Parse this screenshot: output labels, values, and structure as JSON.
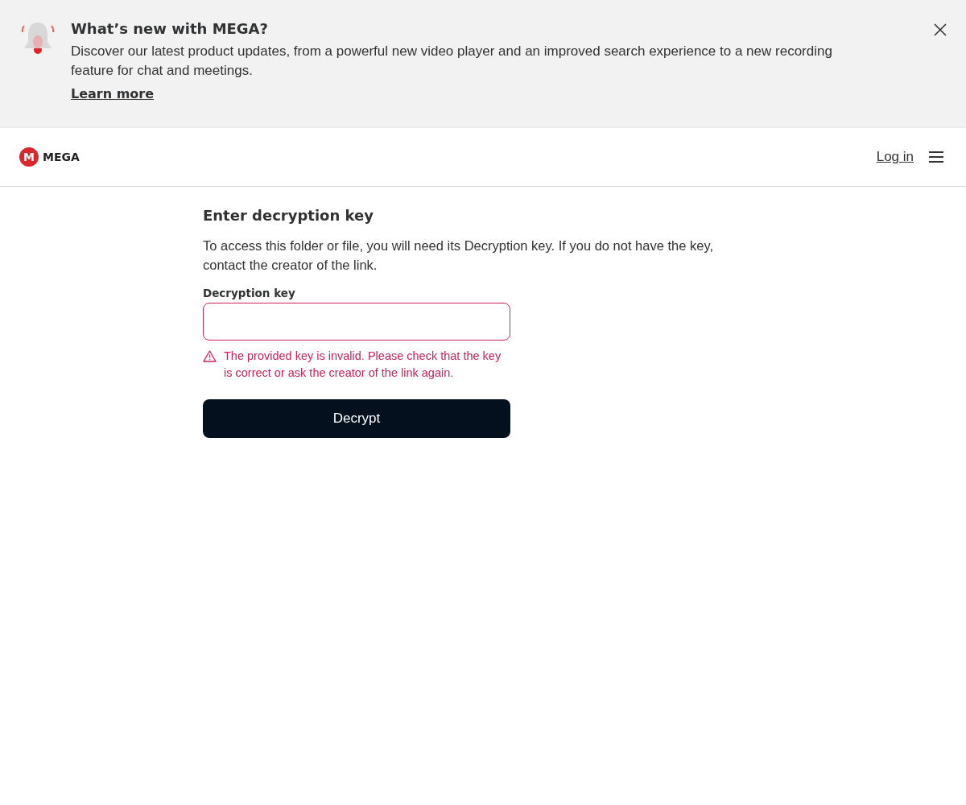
{
  "banner": {
    "title": "What’s new with MEGA?",
    "text": "Discover our latest product updates, from a powerful new video player and an improved search experience to a new recording feature for chat and meetings.",
    "link": "Learn more"
  },
  "header": {
    "logo_mark": "M",
    "logo_name": "MEGA",
    "login": "Log in"
  },
  "form": {
    "title": "Enter decryption key",
    "description": "To access this folder or file, you will need its Decryption key. If you do not have the key, contact the creator of the link.",
    "field_label": "Decryption key",
    "invalid": true,
    "error": "The provided key is invalid. Please check that the key is correct or ask the creator of the link again.",
    "button": "Decrypt"
  }
}
